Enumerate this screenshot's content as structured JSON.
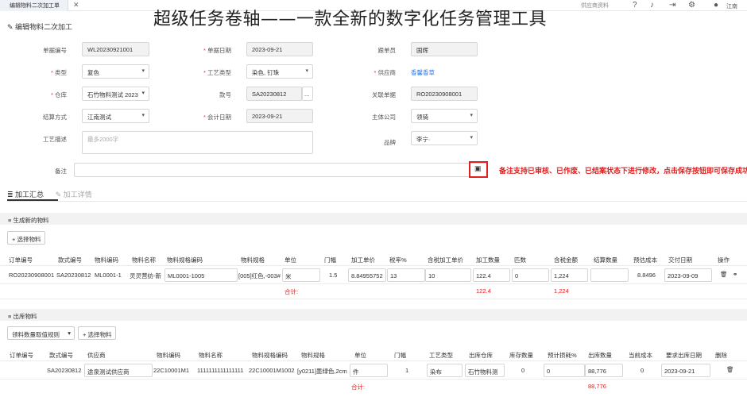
{
  "topbar": {
    "tab_label": "编辑物料二次加工单",
    "tab_close": "✕",
    "search_text": "供应商资料",
    "user_name": "江南"
  },
  "banner": "超级任务卷轴——一款全新的数字化任务管理工具",
  "page_title": "编辑物料二次加工",
  "form": {
    "doc_no_label": "单据编号",
    "doc_no": "WL20230921001",
    "doc_date_label": "单据日期",
    "doc_date": "2023-09-21",
    "follower_label": "跟单员",
    "follower": "国辉",
    "category_label": "类型",
    "category": "复色",
    "process_type_label": "工艺类型",
    "process_type": "染色, 钉珠",
    "supplier_label": "供应商",
    "supplier": "香馨香草",
    "warehouse_label": "仓库",
    "warehouse": "石竹物料测试 2023",
    "style_no_label": "款号",
    "style_no": "SA20230812",
    "style_btn": "...",
    "related_doc_label": "关联单据",
    "related_doc": "RO20230908001",
    "settle_label": "结算方式",
    "settle": "江南测试",
    "acct_date_label": "会计日期",
    "acct_date": "2023-09-21",
    "company_label": "主体公司",
    "company": "领骑",
    "desc_label": "工艺描述",
    "desc_placeholder": "最多2000字",
    "brand_label": "品牌",
    "brand": "李宁·",
    "remark_label": "备注"
  },
  "note": "备注支持已审核、已作废、已结案状态下进行修改，点击保存按钮即可保存成功",
  "tabs": {
    "summary": "加工汇总",
    "detail": "加工详情"
  },
  "section1": {
    "title": "生成新的物料",
    "select_btn": "选择物料",
    "headers": [
      "订单编号",
      "款式编号",
      "物料编码",
      "物料名称",
      "物料规格编码",
      "物料规格",
      "单位",
      "门幅",
      "加工单价",
      "税率%",
      "含税加工单价",
      "加工数量",
      "匹数",
      "含税金额",
      "结算数量",
      "预估成本",
      "交付日期",
      "操作"
    ],
    "row": {
      "order": "RO20230908001",
      "style": "SA20230812",
      "code": "ML0001-1",
      "name": "灵灵营纺-新",
      "spec_code": "ML0001-1005",
      "spec": "[005]红色,-003#",
      "unit": "米",
      "width": "1.5",
      "price": "8.84955752",
      "tax": "13",
      "tax_price": "10",
      "qty": "122.4",
      "bolts": "0",
      "amount": "1,224",
      "settle_qty": "",
      "est_cost": "8.8496",
      "date": "2023-09-09"
    },
    "total_label": "合计:",
    "total_qty": "122.4",
    "total_amount": "1,224"
  },
  "section2": {
    "title": "出库物料",
    "rule_select": "领料数量取值规则",
    "select_btn": "选择物料",
    "headers": [
      "订单编号",
      "款式编号",
      "供应商",
      "物料编码",
      "物料名称",
      "物料规格编码",
      "物料规格",
      "单位",
      "门幅",
      "工艺类型",
      "出库仓库",
      "库存数量",
      "预计损耗%",
      "出库数量",
      "当前成本",
      "要求出库日期",
      "删除"
    ],
    "row": {
      "style": "SA20230812",
      "supplier": "途泉测试供应商",
      "code": "22C10001M1",
      "name": "1111111111111111",
      "spec_code": "22C10001M1002",
      "spec": "[y0211]墨绿色,2cm",
      "unit": "件",
      "width": "1",
      "process": "染布",
      "warehouse": "石竹物料测",
      "stock": "0",
      "loss": "0",
      "qty": "88,776",
      "cost": "0",
      "date": "2023-09-21"
    },
    "total_label": "合计:",
    "total_qty": "88,776"
  }
}
